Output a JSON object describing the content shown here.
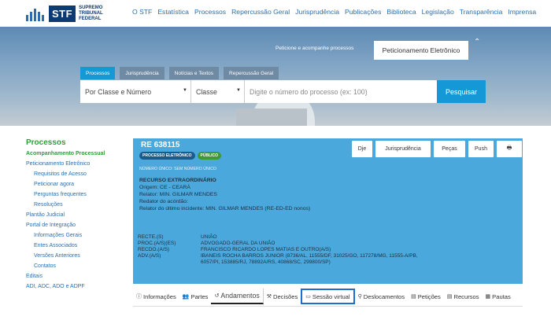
{
  "header": {
    "logo": {
      "mark": "STF",
      "text_lines": [
        "SUPREMO",
        "TRIBUNAL",
        "FEDERAL"
      ]
    },
    "nav": [
      "O STF",
      "Estatística",
      "Processos",
      "Repercussão Geral",
      "Jurisprudência",
      "Publicações",
      "Biblioteca",
      "Legislação",
      "Transparência",
      "Imprensa"
    ]
  },
  "hero": {
    "peticione_label": "Peticione e acompanhe processos",
    "peticione_button": "Peticionamento Eletrônico",
    "tabs": [
      "Processos",
      "Jurisprudência",
      "Notícias e Textos",
      "Repercussão Geral"
    ],
    "search": {
      "by_select": "Por Classe e Número",
      "class_select": "Classe",
      "input_placeholder": "Digite o número do processo (ex: 100)",
      "button": "Pesquisar"
    }
  },
  "sidebar": {
    "title": "Processos",
    "items": [
      {
        "label": "Acompanhamento Processual",
        "bold": true,
        "sub": false
      },
      {
        "label": "Peticionamento Eletrônico",
        "bold": false,
        "sub": false
      },
      {
        "label": "Requisitos de Acesso",
        "bold": false,
        "sub": true
      },
      {
        "label": "Peticionar agora",
        "bold": false,
        "sub": true
      },
      {
        "label": "Perguntas frequentes",
        "bold": false,
        "sub": true
      },
      {
        "label": "Resoluções",
        "bold": false,
        "sub": true
      },
      {
        "label": "Plantão Judicial",
        "bold": false,
        "sub": false
      },
      {
        "label": "Portal de Integração",
        "bold": false,
        "sub": false
      },
      {
        "label": "Informações Gerais",
        "bold": false,
        "sub": true
      },
      {
        "label": "Entes Associados",
        "bold": false,
        "sub": true
      },
      {
        "label": "Versões Anteriores",
        "bold": false,
        "sub": true
      },
      {
        "label": "Contatos",
        "bold": false,
        "sub": true
      },
      {
        "label": "Editais",
        "bold": false,
        "sub": false
      },
      {
        "label": "ADI, ADC, ADO e ADPF",
        "bold": false,
        "sub": false
      }
    ]
  },
  "process": {
    "id": "RE 638115",
    "badges": [
      "PROCESSO ELETRÔNICO",
      "PÚBLICO"
    ],
    "numero_unico": "NÚMERO ÚNICO: SEM NÚMERO ÚNICO",
    "classe": "RECURSO EXTRAORDINÁRIO",
    "origem": "Origem: CE - CEARÁ",
    "relator": "Relator: MIN. GILMAR MENDES",
    "redator": "Redator do acórdão:",
    "relator_ultimo": "Relator do último incidente: MIN. GILMAR MENDES (RE-ED-ED nonos)",
    "actions": [
      "Dje",
      "Jurisprudência",
      "Peças",
      "Push",
      "print"
    ],
    "parts": [
      {
        "k": "RECTE.(S)",
        "v": "UNIÃO"
      },
      {
        "k": "PROC.(A/S)(ES)",
        "v": "ADVOGADO-GERAL DA UNIÃO"
      },
      {
        "k": "RECDO.(A/S)",
        "v": "FRANCISCO RICARDO LOPES MATIAS E OUTRO(A/S)"
      },
      {
        "k": "ADV.(A/S)",
        "v": "IBANEIS ROCHA BARROS JUNIOR (8736/AL, 11555/DF, 31025/GO, 117278/MG, 11555-A/PB, 6057/PI, 153885/RJ, 78892A/RS, 40868/SC, 299800/SP)"
      }
    ]
  },
  "tabbar": [
    {
      "icon": "info-icon",
      "glyph": "ⓘ",
      "label": "Informações",
      "state": ""
    },
    {
      "icon": "people-icon",
      "glyph": "👥",
      "label": "Partes",
      "state": ""
    },
    {
      "icon": "history-icon",
      "glyph": "↺",
      "label": "Andamentos",
      "state": "sel"
    },
    {
      "icon": "gavel-icon",
      "glyph": "⚒",
      "label": "Decisões",
      "state": ""
    },
    {
      "icon": "monitor-icon",
      "glyph": "▭",
      "label": "Sessão virtual",
      "state": "focus"
    },
    {
      "icon": "pin-icon",
      "glyph": "⚲",
      "label": "Deslocamentos",
      "state": ""
    },
    {
      "icon": "document-icon",
      "glyph": "▤",
      "label": "Petições",
      "state": ""
    },
    {
      "icon": "document-icon",
      "glyph": "▤",
      "label": "Recursos",
      "state": ""
    },
    {
      "icon": "calendar-icon",
      "glyph": "▦",
      "label": "Pautas",
      "state": ""
    }
  ]
}
